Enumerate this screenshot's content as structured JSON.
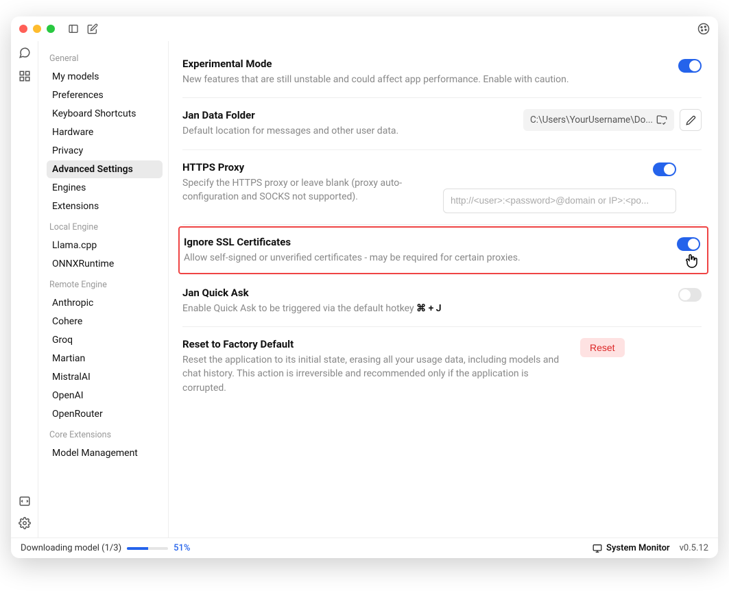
{
  "sidebar": {
    "sections": [
      {
        "label": "General",
        "items": [
          "My models",
          "Preferences",
          "Keyboard Shortcuts",
          "Hardware",
          "Privacy",
          "Advanced Settings",
          "Engines",
          "Extensions"
        ],
        "activeIndex": 5
      },
      {
        "label": "Local Engine",
        "items": [
          "Llama.cpp",
          "ONNXRuntime"
        ]
      },
      {
        "label": "Remote Engine",
        "items": [
          "Anthropic",
          "Cohere",
          "Groq",
          "Martian",
          "MistralAI",
          "OpenAI",
          "OpenRouter"
        ]
      },
      {
        "label": "Core Extensions",
        "items": [
          "Model Management"
        ]
      }
    ]
  },
  "settings": {
    "experimental": {
      "title": "Experimental Mode",
      "desc": "New features that are still unstable and could affect app performance. Enable with caution."
    },
    "dataFolder": {
      "title": "Jan Data Folder",
      "desc": "Default location for messages and other user data.",
      "path": "C:\\Users\\YourUsername\\Do..."
    },
    "proxy": {
      "title": "HTTPS Proxy",
      "desc": "Specify the HTTPS proxy or leave blank (proxy auto-configuration and SOCKS not supported).",
      "placeholder": "http://<user>:<password>@domain or IP>:<po..."
    },
    "ssl": {
      "title": "Ignore SSL Certificates",
      "desc": "Allow self-signed or unverified certificates - may be required for certain proxies."
    },
    "quickAsk": {
      "title": "Jan Quick Ask",
      "descPrefix": "Enable Quick Ask to be triggered via the default hotkey ",
      "hotkey": "⌘ + J"
    },
    "reset": {
      "title": "Reset to Factory Default",
      "desc": "Reset the application to its initial state, erasing all your usage data, including models and chat history. This action is irreversible and recommended only if the application is corrupted.",
      "button": "Reset"
    }
  },
  "footer": {
    "downloading": "Downloading model (1/3)",
    "percent": "51%",
    "percentNum": 51,
    "sysmon": "System Monitor",
    "version": "v0.5.12"
  }
}
